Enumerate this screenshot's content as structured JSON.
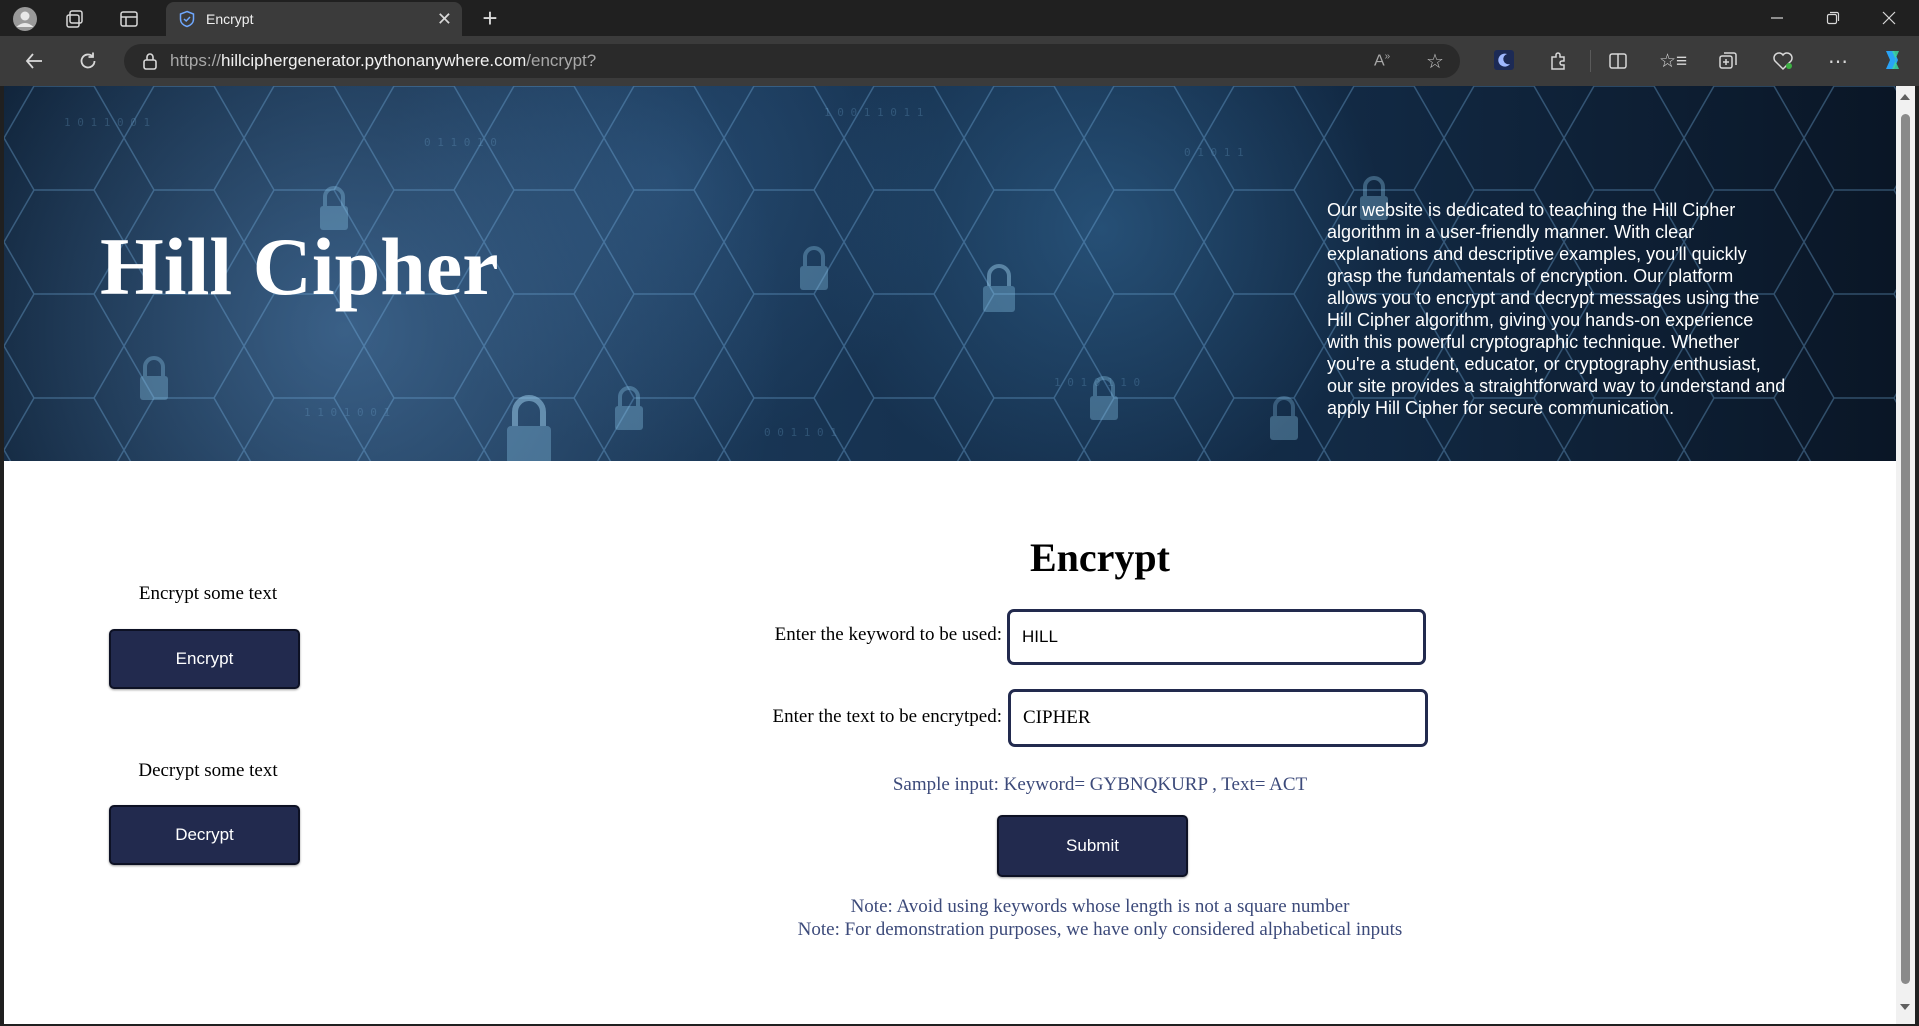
{
  "browser": {
    "tab_title": "Encrypt",
    "url_scheme": "https://",
    "url_host": "hillciphergenerator.pythonanywhere.com",
    "url_path": "/encrypt?"
  },
  "hero": {
    "title": "Hill Cipher",
    "description": "Our website is dedicated to teaching the Hill Cipher algorithm in a user-friendly manner. With clear explanations and descriptive examples, you'll quickly grasp the fundamentals of encryption. Our platform allows you to encrypt and decrypt messages using the Hill Cipher algorithm, giving you hands-on experience with this powerful cryptographic technique. Whether you're a student, educator, or cryptography enthusiast, our site provides a straightforward way to understand and apply Hill Cipher for secure communication."
  },
  "sidebar": {
    "encrypt_label": "Encrypt some text",
    "encrypt_button": "Encrypt",
    "decrypt_label": "Decrypt some text",
    "decrypt_button": "Decrypt"
  },
  "form": {
    "title": "Encrypt",
    "keyword_label": "Enter the keyword to be used:",
    "keyword_value": "HILL",
    "text_label": "Enter the text to be encrytped:",
    "text_value": "CIPHER",
    "sample": "Sample input: Keyword= GYBNQKURP , Text= ACT",
    "submit_label": "Submit",
    "note1": "Note: Avoid using keywords whose length is not a square number",
    "note2": "Note: For demonstration purposes, we have only considered alphabetical inputs"
  },
  "colors": {
    "button_bg": "#222a4e",
    "hint_text": "#3c4a7a",
    "chrome_bg": "#202020"
  }
}
